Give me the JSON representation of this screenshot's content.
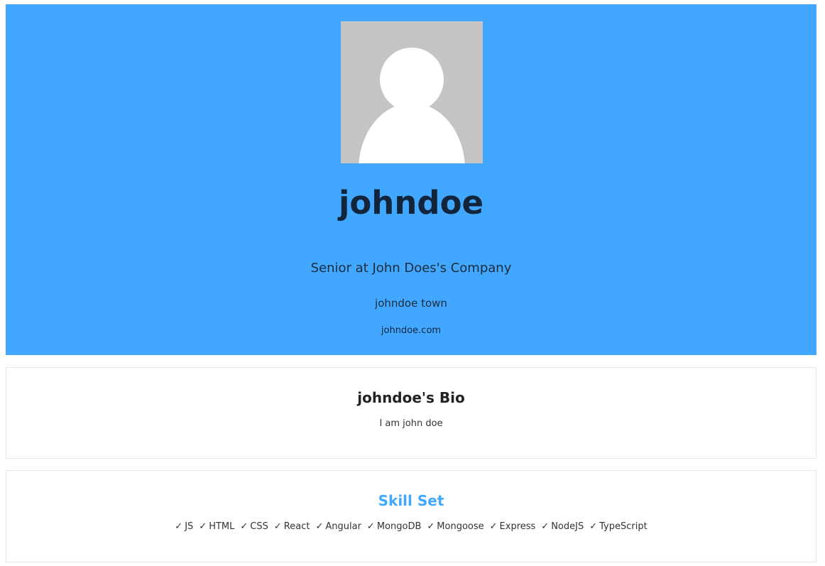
{
  "profile": {
    "avatar_icon": "default-user-avatar-icon",
    "username": "johndoe",
    "status": "Senior at John Does's Company",
    "location": "johndoe town",
    "website": "johndoe.com",
    "colors": {
      "header_background": "#42a8ff",
      "avatar_background": "#c4c4c4"
    }
  },
  "bio": {
    "title": "johndoe's Bio",
    "text": "I am john doe"
  },
  "skills": {
    "title": "Skill Set",
    "check_icon": "check-icon",
    "items": [
      {
        "label": "JS"
      },
      {
        "label": "HTML"
      },
      {
        "label": "CSS"
      },
      {
        "label": "React"
      },
      {
        "label": "Angular"
      },
      {
        "label": "MongoDB"
      },
      {
        "label": "Mongoose"
      },
      {
        "label": "Express"
      },
      {
        "label": "NodeJS"
      },
      {
        "label": "TypeScript"
      }
    ]
  }
}
